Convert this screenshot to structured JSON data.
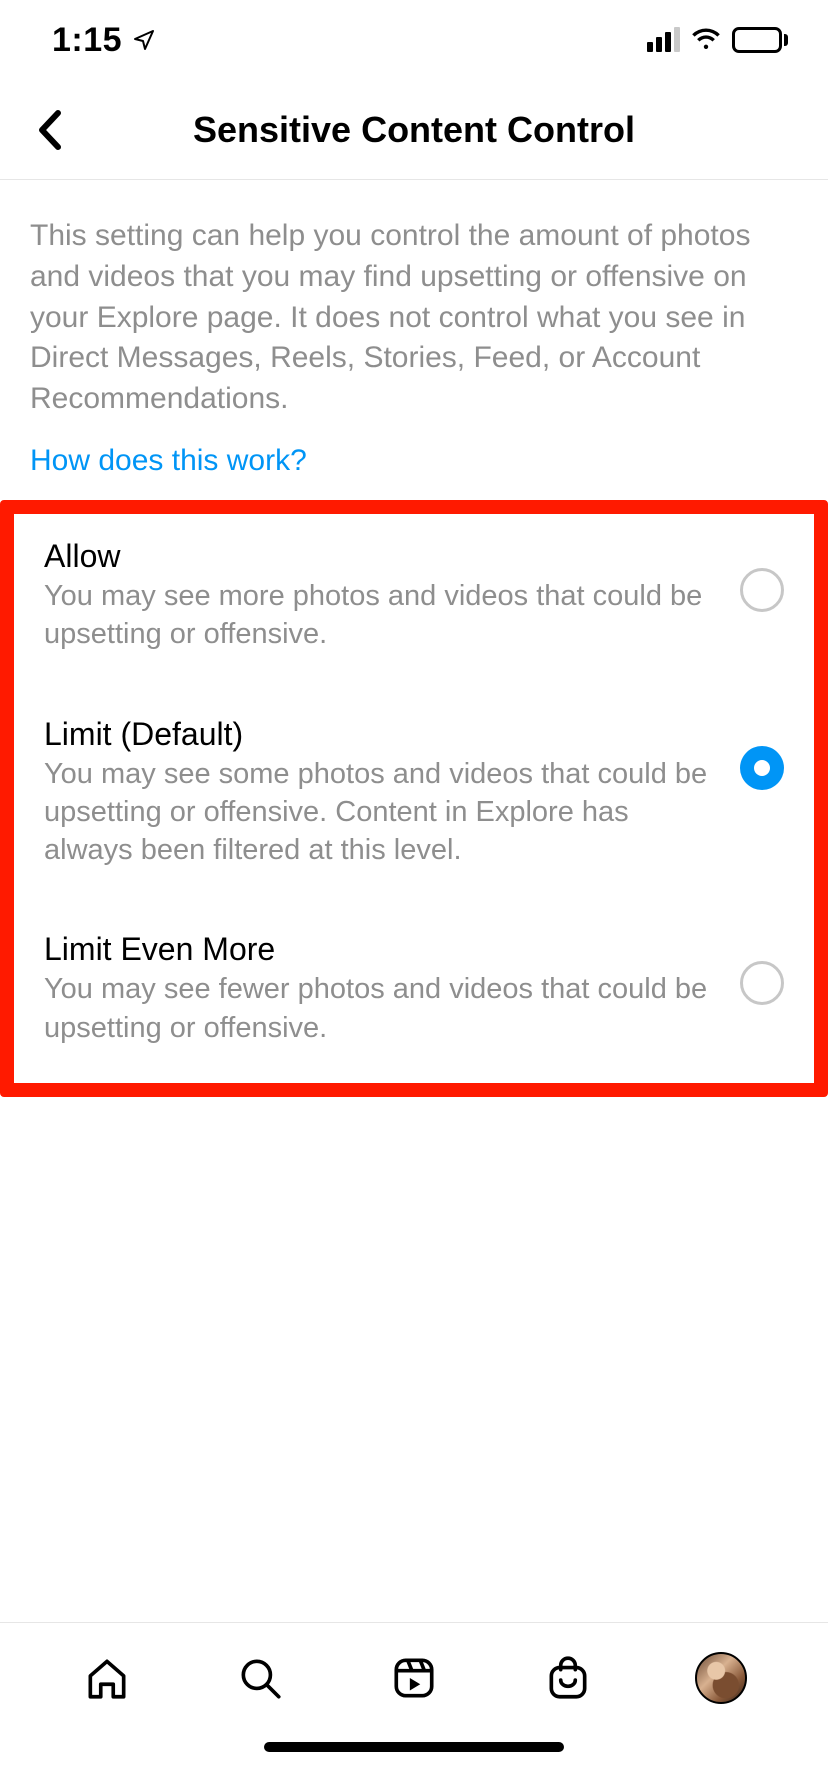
{
  "statusbar": {
    "time": "1:15"
  },
  "header": {
    "title": "Sensitive Content Control"
  },
  "content": {
    "description": "This setting can help you control the amount of photos and videos that you may find upsetting or offensive on your Explore page. It does not control what you see in Direct Messages, Reels, Stories, Feed, or Account Recommendations.",
    "help_link": "How does this work?",
    "options": [
      {
        "title": "Allow",
        "desc": "You may see more photos and videos that could be upsetting or offensive.",
        "selected": false
      },
      {
        "title": "Limit (Default)",
        "desc": "You may see some photos and videos that could be upsetting or offensive. Content in Explore has always been filtered at this level.",
        "selected": true
      },
      {
        "title": "Limit Even More",
        "desc": "You may see fewer photos and videos that could be upsetting or offensive.",
        "selected": false
      }
    ]
  },
  "tabbar": {
    "items": [
      "home",
      "search",
      "reels",
      "shop",
      "profile"
    ]
  }
}
